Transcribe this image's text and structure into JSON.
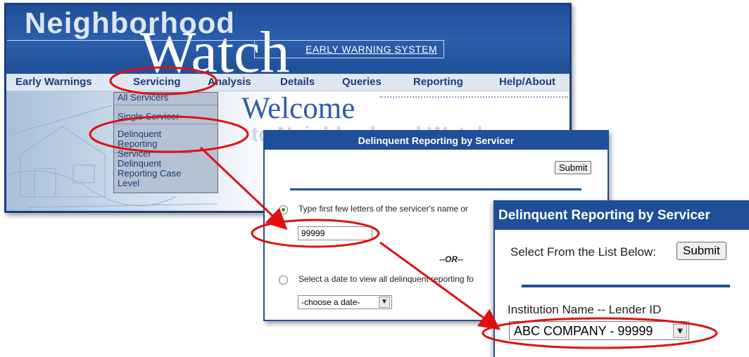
{
  "app": {
    "title_line1": "Neighborhood",
    "title_line2": "Watch",
    "subtitle": "EARLY WARNING SYSTEM",
    "menu": [
      {
        "label": "Early Warnings"
      },
      {
        "label": "Servicing"
      },
      {
        "label": "Analysis"
      },
      {
        "label": "Details"
      },
      {
        "label": "Queries"
      },
      {
        "label": "Reporting"
      },
      {
        "label": "Help/About"
      }
    ],
    "servicing_dropdown": [
      {
        "label": "All Servicers"
      },
      {
        "label": "Single Servicer"
      },
      {
        "label": "Delinquent Reporting Servicer"
      },
      {
        "label": "Delinquent Reporting Case Level"
      }
    ],
    "welcome_line1": "Welcome",
    "welcome_line2": "to Neighborhood Watch"
  },
  "form": {
    "title": "Delinquent Reporting by Servicer",
    "submit_label": "Submit",
    "option1_label": "Type first few letters of the servicer's name or",
    "servicer_input_value": "99999",
    "or_label": "--OR--",
    "option2_label": "Select a date to view all delinquent reporting fo",
    "date_select_value": "-choose a date-"
  },
  "zoom": {
    "title": "Delinquent Reporting by Servicer",
    "select_prompt": "Select From the List Below:",
    "submit_label": "Submit",
    "field_label": "Institution Name -- Lender ID",
    "institution_value": "ABC COMPANY - 99999"
  },
  "colors": {
    "brand_blue": "#1f4f99",
    "highlight_red": "#e01010",
    "menu_text": "#1c3d77"
  },
  "icons": {
    "radio_selected": "radio-selected-icon",
    "radio_unselected": "radio-unselected-icon",
    "dropdown_arrow": "chevron-down-icon"
  }
}
